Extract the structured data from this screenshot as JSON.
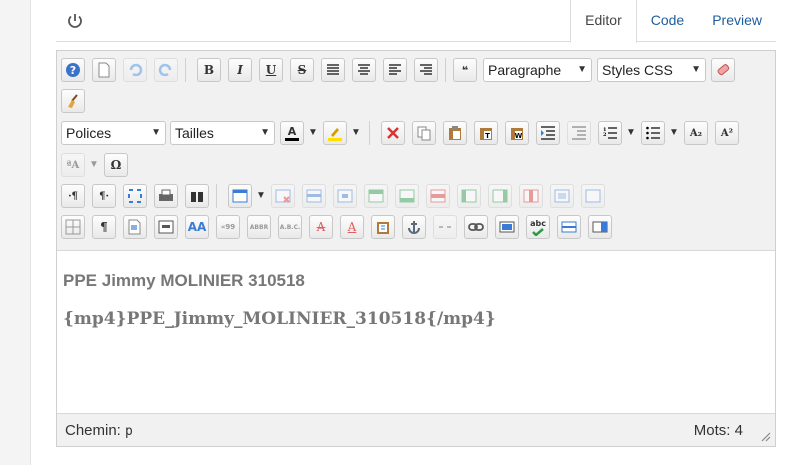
{
  "tabs": [
    {
      "label": "Editor",
      "active": true
    },
    {
      "label": "Code",
      "active": false
    },
    {
      "label": "Preview",
      "active": false
    }
  ],
  "toolbar": {
    "format_select": "Paragraphe",
    "styles_select": "Styles CSS",
    "font_select": "Polices",
    "size_select": "Tailles",
    "bold_label": "B",
    "italic_label": "I",
    "underline_label": "U",
    "strike_label": "S",
    "quote_label": "❝",
    "omega_label": "Ω",
    "subscript_label": "A₂",
    "superscript_label": "A²",
    "text_color_label": "A",
    "pilcrow_label": "¶",
    "abbr_label": "ABBR",
    "abc_label": "A.B.C.",
    "quote_text_label": "«99",
    "spell_label": "abc"
  },
  "content": {
    "heading": "PPE Jimmy MOLINIER 310518",
    "media_tag": "{mp4}PPE_Jimmy_MOLINIER_310518{/mp4}"
  },
  "status": {
    "path_label": "Chemin:",
    "path_value": "p",
    "words_label": "Mots:",
    "words_value": "4"
  },
  "colors": {
    "link": "#1f5d9e",
    "text_color_bar": "#000000",
    "highlight_bar": "#ffe000"
  }
}
